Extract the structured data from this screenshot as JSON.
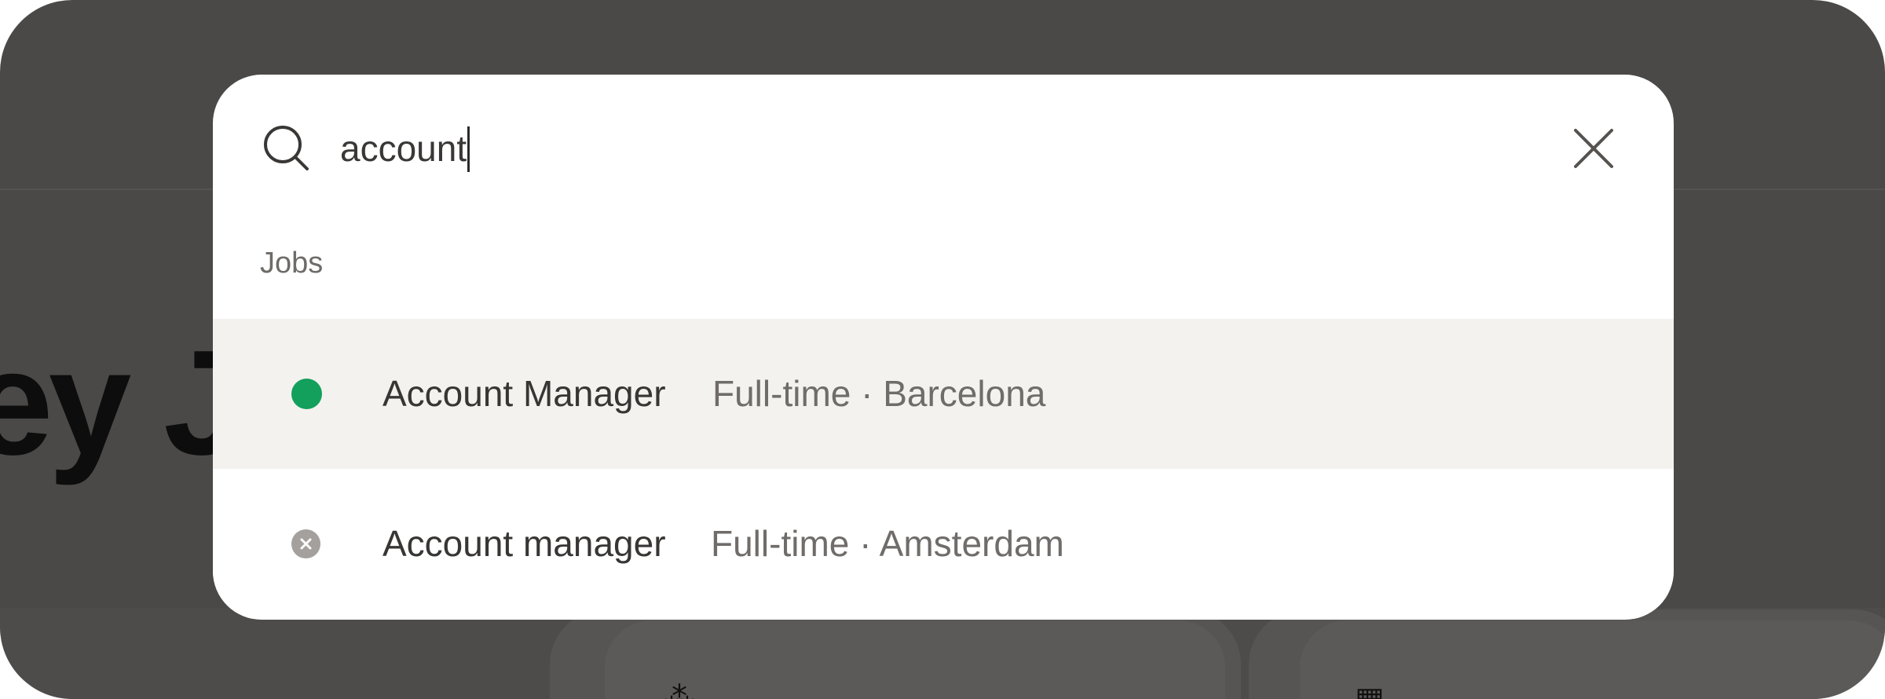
{
  "background": {
    "heading_fragment": "ey J"
  },
  "search": {
    "value": "account",
    "icon": "search-icon",
    "close_icon": "close-icon"
  },
  "results": {
    "section_label": "Jobs",
    "items": [
      {
        "title": "Account Manager",
        "meta": "Full-time · Barcelona",
        "status": "open",
        "status_color": "#12a05c",
        "highlighted": true
      },
      {
        "title": "Account manager",
        "meta": "Full-time · Amsterdam",
        "status": "closed",
        "status_color": "#a3a09d",
        "highlighted": false
      }
    ]
  },
  "colors": {
    "overlay": "#4b4947",
    "modal": "#ffffff",
    "highlight_row": "#f3f2ef",
    "text_primary": "#383634",
    "text_secondary": "#6f6c69"
  }
}
